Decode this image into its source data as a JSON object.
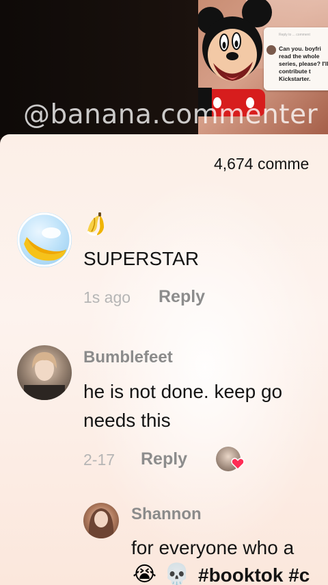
{
  "video": {
    "watermark": "@banana.commenter",
    "pip_note": {
      "reply_to": "Reply to ... comment",
      "text": "Can you. boyfri read the whole series, please? I'll contribute t Kickstarter."
    }
  },
  "comments_panel": {
    "count_label": "4,674 comme",
    "comments": [
      {
        "username_icon": "banana-emoji",
        "text": "SUPERSTAR",
        "time": "1s ago",
        "reply_label": "Reply"
      },
      {
        "username": "Bumblefeet",
        "text_line1": "he is not done. keep go",
        "text_line2": "needs this",
        "time": "2-17",
        "reply_label": "Reply",
        "creator_liked": true
      },
      {
        "username": "Shannon",
        "text_line1": "for everyone who a",
        "emoji1": "😭",
        "emoji2": "💀",
        "hashtag_text": "#booktok #c"
      }
    ]
  },
  "colors": {
    "sheet_bg": "#fcefe7",
    "heart": "#ff2d55",
    "meta_text": "#b5b5b5"
  }
}
